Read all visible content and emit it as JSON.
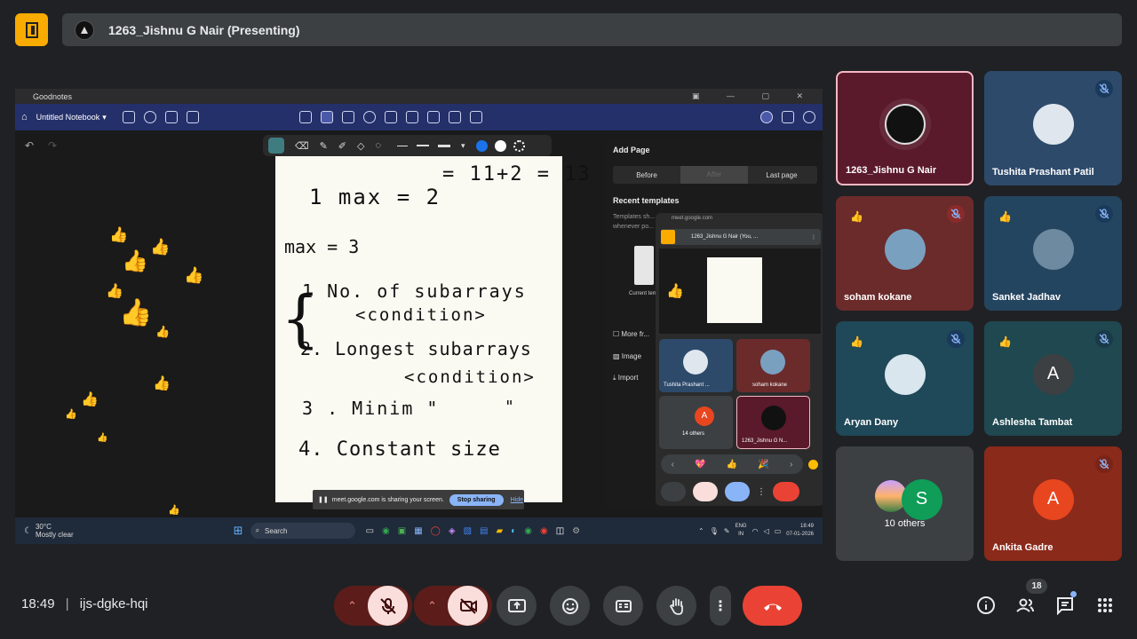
{
  "meeting": {
    "presenter_title": "1263_Jishnu G Nair (Presenting)",
    "time": "18:49",
    "code": "ijs-dgke-hqi",
    "participant_count": "18"
  },
  "shared_screen": {
    "app_name": "Goodnotes",
    "notebook_title": "Untitled Notebook",
    "handwriting": [
      "= 11+2 = 13",
      "1  max = 2",
      "max = 3",
      "1 No. of subarrays",
      "<condition>",
      "2. Longest subarrays",
      "<condition>",
      "3 . Minim \"",
      "\"",
      "4. Constant size"
    ],
    "add_page_title": "Add Page",
    "add_page_options": [
      "Before",
      "After",
      "Last page"
    ],
    "recent_templates": "Recent templates",
    "templates_hint": "Templates sh... whenever po...",
    "current_template": "Current tem...",
    "side_menu": [
      "More fr...",
      "Image",
      "Import"
    ],
    "share_notice": "meet.google.com is sharing your screen.",
    "stop_sharing": "Stop sharing",
    "hide": "Hide",
    "weather_temp": "30°C",
    "weather_desc": "Mostly clear",
    "taskbar_search": "Search",
    "lang_top": "ENG",
    "lang_bottom": "IN",
    "tray_time": "18:49",
    "tray_date": "07-01-2026",
    "pip": {
      "url": "meet.google.com",
      "title": "1263_Jishnu G Nair (You, ...",
      "tiles": [
        "Tushita Prashant ...",
        "soham kokane",
        "14 others",
        "1263_Jishnu G N..."
      ]
    }
  },
  "participants": [
    {
      "name": "1263_Jishnu G Nair",
      "bg": "#5a1a2b",
      "avatar_bg": "#111111",
      "initial": "",
      "muted": false,
      "highlight": true
    },
    {
      "name": "Tushita Prashant Patil",
      "bg": "#2d4a6b",
      "avatar_bg": "#dfe6ee",
      "initial": "",
      "muted": true,
      "badge_color": "#1a3a5c"
    },
    {
      "name": "soham kokane",
      "bg": "#6b2b2b",
      "avatar_bg": "#7aa0c0",
      "initial": "",
      "muted": true,
      "badge_color": "#8b2a2a"
    },
    {
      "name": "Sanket Jadhav",
      "bg": "#244560",
      "avatar_bg": "#6d8aa0",
      "initial": "",
      "muted": true,
      "badge_color": "#1a3a5c"
    },
    {
      "name": "Aryan Dany",
      "bg": "#1f4858",
      "avatar_bg": "#d9e6ee",
      "initial": "",
      "muted": true,
      "badge_color": "#1a3a5c"
    },
    {
      "name": "Ashlesha Tambat",
      "bg": "#1f4850",
      "avatar_bg": "#3c4043",
      "initial": "A",
      "muted": true,
      "badge_color": "#1a3a4a"
    },
    {
      "name": "10 others",
      "bg": "#3c4043",
      "avatar_bg": "#0f9d58",
      "initial": "S",
      "muted": false
    },
    {
      "name": "Ankita Gadre",
      "bg": "#8a2a1a",
      "avatar_bg": "#e8461f",
      "initial": "A",
      "muted": true,
      "badge_color": "#7a2418"
    }
  ],
  "colors": {
    "accent_red": "#ea4335",
    "mic_off_bg": "#f9dedc",
    "mic_off_side": "#5c1d1a",
    "logo": "#f9ab00"
  }
}
